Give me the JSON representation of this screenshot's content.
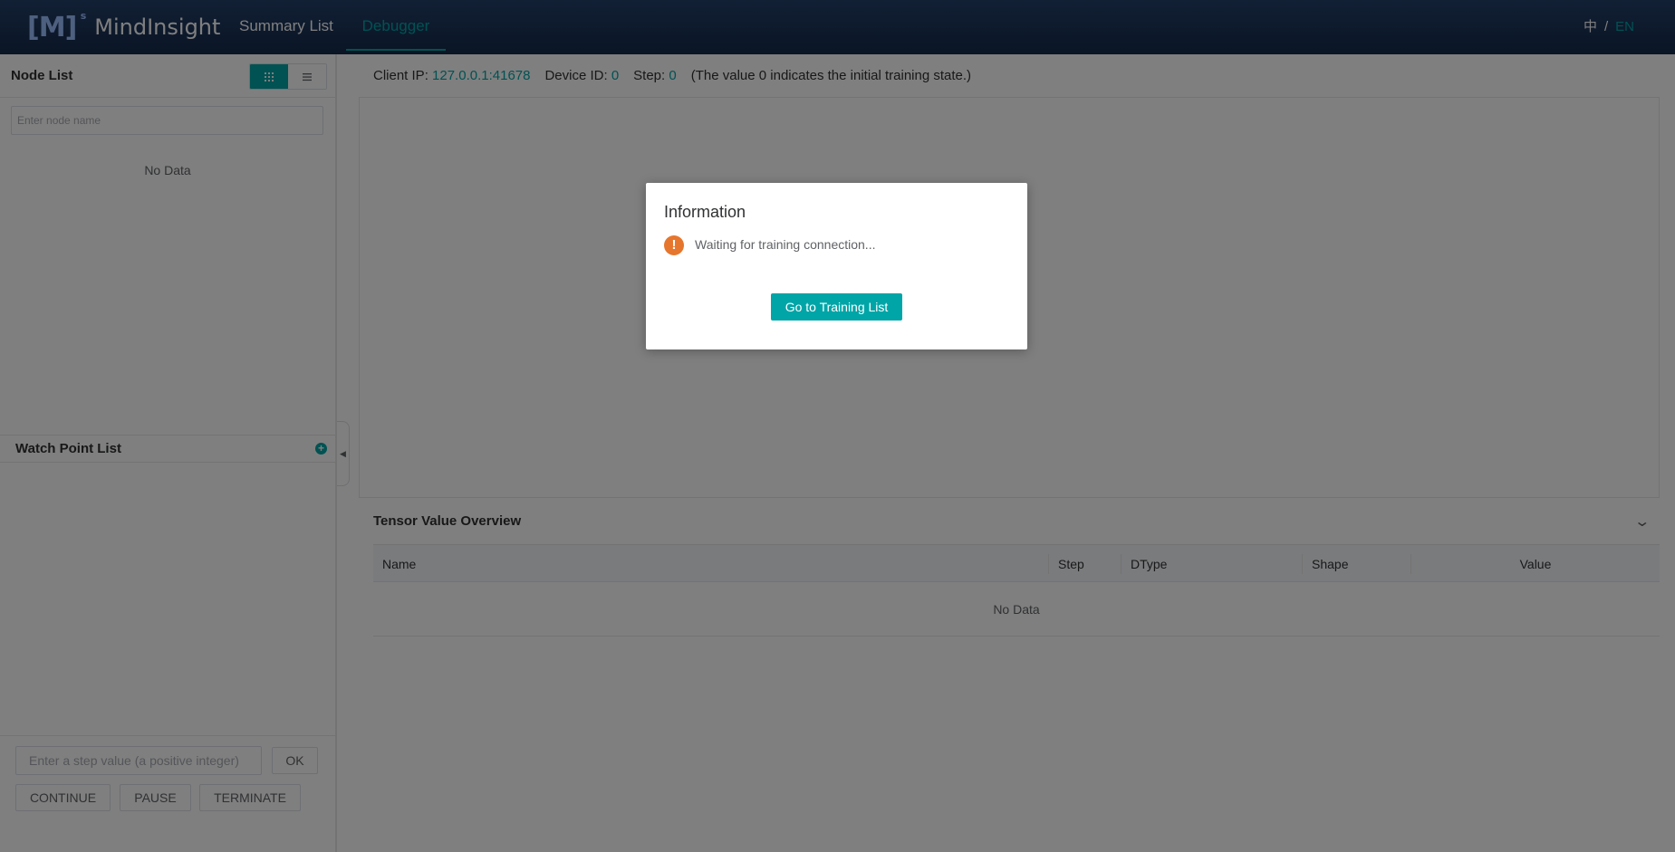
{
  "header": {
    "logo_mark": "[M]",
    "logo_sup": "s",
    "app_name": "MindInsight",
    "nav": [
      {
        "label": "Summary List"
      },
      {
        "label": "Debugger"
      }
    ],
    "lang_zh": "中",
    "lang_sep": "/",
    "lang_en": "EN"
  },
  "left": {
    "node_list_title": "Node List",
    "view_icons": {
      "grid": "grid-icon",
      "list": "list-icon"
    },
    "node_search_placeholder": "Enter node name",
    "node_no_data": "No Data",
    "watch_point_title": "Watch Point List",
    "add_icon": "+",
    "step_placeholder": "Enter a step value (a positive integer)",
    "ok_label": "OK",
    "continue_label": "CONTINUE",
    "pause_label": "PAUSE",
    "terminate_label": "TERMINATE"
  },
  "right": {
    "client_ip_label": "Client IP:",
    "client_ip_value": "127.0.0.1:41678",
    "device_id_label": "Device ID:",
    "device_id_value": "0",
    "step_label": "Step:",
    "step_value": "0",
    "step_note": "(The value 0 indicates the initial training state.)",
    "tensor_title": "Tensor Value Overview",
    "columns": {
      "name": "Name",
      "step": "Step",
      "dtype": "DType",
      "shape": "Shape",
      "value": "Value"
    },
    "table_no_data": "No Data"
  },
  "dialog": {
    "title": "Information",
    "message": "Waiting for training connection...",
    "button_label": "Go to Training List"
  },
  "colors": {
    "accent": "#00a5a7",
    "header": "#1c3558",
    "warning": "#e6762d"
  }
}
